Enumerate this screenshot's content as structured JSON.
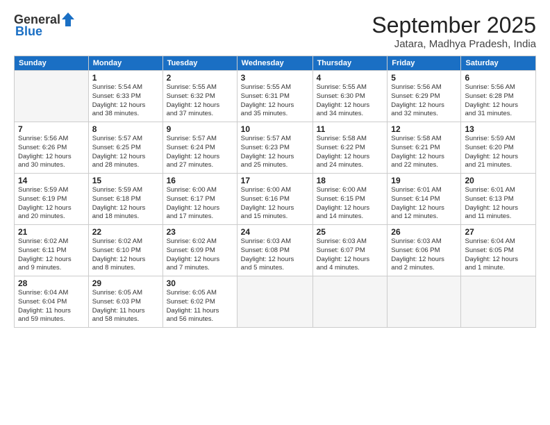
{
  "header": {
    "logo_general": "General",
    "logo_blue": "Blue",
    "month_title": "September 2025",
    "location": "Jatara, Madhya Pradesh, India"
  },
  "days_of_week": [
    "Sunday",
    "Monday",
    "Tuesday",
    "Wednesday",
    "Thursday",
    "Friday",
    "Saturday"
  ],
  "weeks": [
    [
      {
        "day": "",
        "info": ""
      },
      {
        "day": "1",
        "info": "Sunrise: 5:54 AM\nSunset: 6:33 PM\nDaylight: 12 hours\nand 38 minutes."
      },
      {
        "day": "2",
        "info": "Sunrise: 5:55 AM\nSunset: 6:32 PM\nDaylight: 12 hours\nand 37 minutes."
      },
      {
        "day": "3",
        "info": "Sunrise: 5:55 AM\nSunset: 6:31 PM\nDaylight: 12 hours\nand 35 minutes."
      },
      {
        "day": "4",
        "info": "Sunrise: 5:55 AM\nSunset: 6:30 PM\nDaylight: 12 hours\nand 34 minutes."
      },
      {
        "day": "5",
        "info": "Sunrise: 5:56 AM\nSunset: 6:29 PM\nDaylight: 12 hours\nand 32 minutes."
      },
      {
        "day": "6",
        "info": "Sunrise: 5:56 AM\nSunset: 6:28 PM\nDaylight: 12 hours\nand 31 minutes."
      }
    ],
    [
      {
        "day": "7",
        "info": "Sunrise: 5:56 AM\nSunset: 6:26 PM\nDaylight: 12 hours\nand 30 minutes."
      },
      {
        "day": "8",
        "info": "Sunrise: 5:57 AM\nSunset: 6:25 PM\nDaylight: 12 hours\nand 28 minutes."
      },
      {
        "day": "9",
        "info": "Sunrise: 5:57 AM\nSunset: 6:24 PM\nDaylight: 12 hours\nand 27 minutes."
      },
      {
        "day": "10",
        "info": "Sunrise: 5:57 AM\nSunset: 6:23 PM\nDaylight: 12 hours\nand 25 minutes."
      },
      {
        "day": "11",
        "info": "Sunrise: 5:58 AM\nSunset: 6:22 PM\nDaylight: 12 hours\nand 24 minutes."
      },
      {
        "day": "12",
        "info": "Sunrise: 5:58 AM\nSunset: 6:21 PM\nDaylight: 12 hours\nand 22 minutes."
      },
      {
        "day": "13",
        "info": "Sunrise: 5:59 AM\nSunset: 6:20 PM\nDaylight: 12 hours\nand 21 minutes."
      }
    ],
    [
      {
        "day": "14",
        "info": "Sunrise: 5:59 AM\nSunset: 6:19 PM\nDaylight: 12 hours\nand 20 minutes."
      },
      {
        "day": "15",
        "info": "Sunrise: 5:59 AM\nSunset: 6:18 PM\nDaylight: 12 hours\nand 18 minutes."
      },
      {
        "day": "16",
        "info": "Sunrise: 6:00 AM\nSunset: 6:17 PM\nDaylight: 12 hours\nand 17 minutes."
      },
      {
        "day": "17",
        "info": "Sunrise: 6:00 AM\nSunset: 6:16 PM\nDaylight: 12 hours\nand 15 minutes."
      },
      {
        "day": "18",
        "info": "Sunrise: 6:00 AM\nSunset: 6:15 PM\nDaylight: 12 hours\nand 14 minutes."
      },
      {
        "day": "19",
        "info": "Sunrise: 6:01 AM\nSunset: 6:14 PM\nDaylight: 12 hours\nand 12 minutes."
      },
      {
        "day": "20",
        "info": "Sunrise: 6:01 AM\nSunset: 6:13 PM\nDaylight: 12 hours\nand 11 minutes."
      }
    ],
    [
      {
        "day": "21",
        "info": "Sunrise: 6:02 AM\nSunset: 6:11 PM\nDaylight: 12 hours\nand 9 minutes."
      },
      {
        "day": "22",
        "info": "Sunrise: 6:02 AM\nSunset: 6:10 PM\nDaylight: 12 hours\nand 8 minutes."
      },
      {
        "day": "23",
        "info": "Sunrise: 6:02 AM\nSunset: 6:09 PM\nDaylight: 12 hours\nand 7 minutes."
      },
      {
        "day": "24",
        "info": "Sunrise: 6:03 AM\nSunset: 6:08 PM\nDaylight: 12 hours\nand 5 minutes."
      },
      {
        "day": "25",
        "info": "Sunrise: 6:03 AM\nSunset: 6:07 PM\nDaylight: 12 hours\nand 4 minutes."
      },
      {
        "day": "26",
        "info": "Sunrise: 6:03 AM\nSunset: 6:06 PM\nDaylight: 12 hours\nand 2 minutes."
      },
      {
        "day": "27",
        "info": "Sunrise: 6:04 AM\nSunset: 6:05 PM\nDaylight: 12 hours\nand 1 minute."
      }
    ],
    [
      {
        "day": "28",
        "info": "Sunrise: 6:04 AM\nSunset: 6:04 PM\nDaylight: 11 hours\nand 59 minutes."
      },
      {
        "day": "29",
        "info": "Sunrise: 6:05 AM\nSunset: 6:03 PM\nDaylight: 11 hours\nand 58 minutes."
      },
      {
        "day": "30",
        "info": "Sunrise: 6:05 AM\nSunset: 6:02 PM\nDaylight: 11 hours\nand 56 minutes."
      },
      {
        "day": "",
        "info": ""
      },
      {
        "day": "",
        "info": ""
      },
      {
        "day": "",
        "info": ""
      },
      {
        "day": "",
        "info": ""
      }
    ]
  ]
}
